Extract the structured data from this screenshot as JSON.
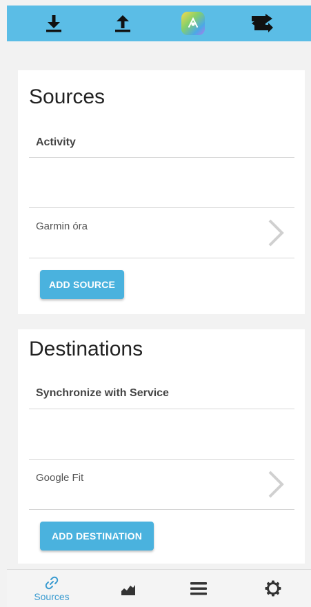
{
  "toolbar": {
    "download_icon": "download-icon",
    "upload_icon": "upload-icon",
    "logo_icon": "app-logo-icon",
    "sync_icon": "sync-arrows-icon"
  },
  "sources": {
    "title": "Sources",
    "section_header": "Activity",
    "items": [
      {
        "label": "Garmin óra"
      }
    ],
    "add_button": "ADD SOURCE"
  },
  "destinations": {
    "title": "Destinations",
    "section_header": "Synchronize with Service",
    "items": [
      {
        "label": "Google Fit"
      }
    ],
    "add_button": "ADD DESTINATION"
  },
  "bottom_nav": {
    "items": [
      {
        "label": "Sources",
        "icon": "link-icon",
        "active": true
      },
      {
        "label": "",
        "icon": "chart-icon",
        "active": false
      },
      {
        "label": "",
        "icon": "menu-icon",
        "active": false
      },
      {
        "label": "",
        "icon": "settings-icon",
        "active": false
      }
    ]
  },
  "colors": {
    "accent": "#5bbde6",
    "button": "#4ab2de",
    "active_nav": "#3a9bd0",
    "background": "#f2f2f2"
  }
}
